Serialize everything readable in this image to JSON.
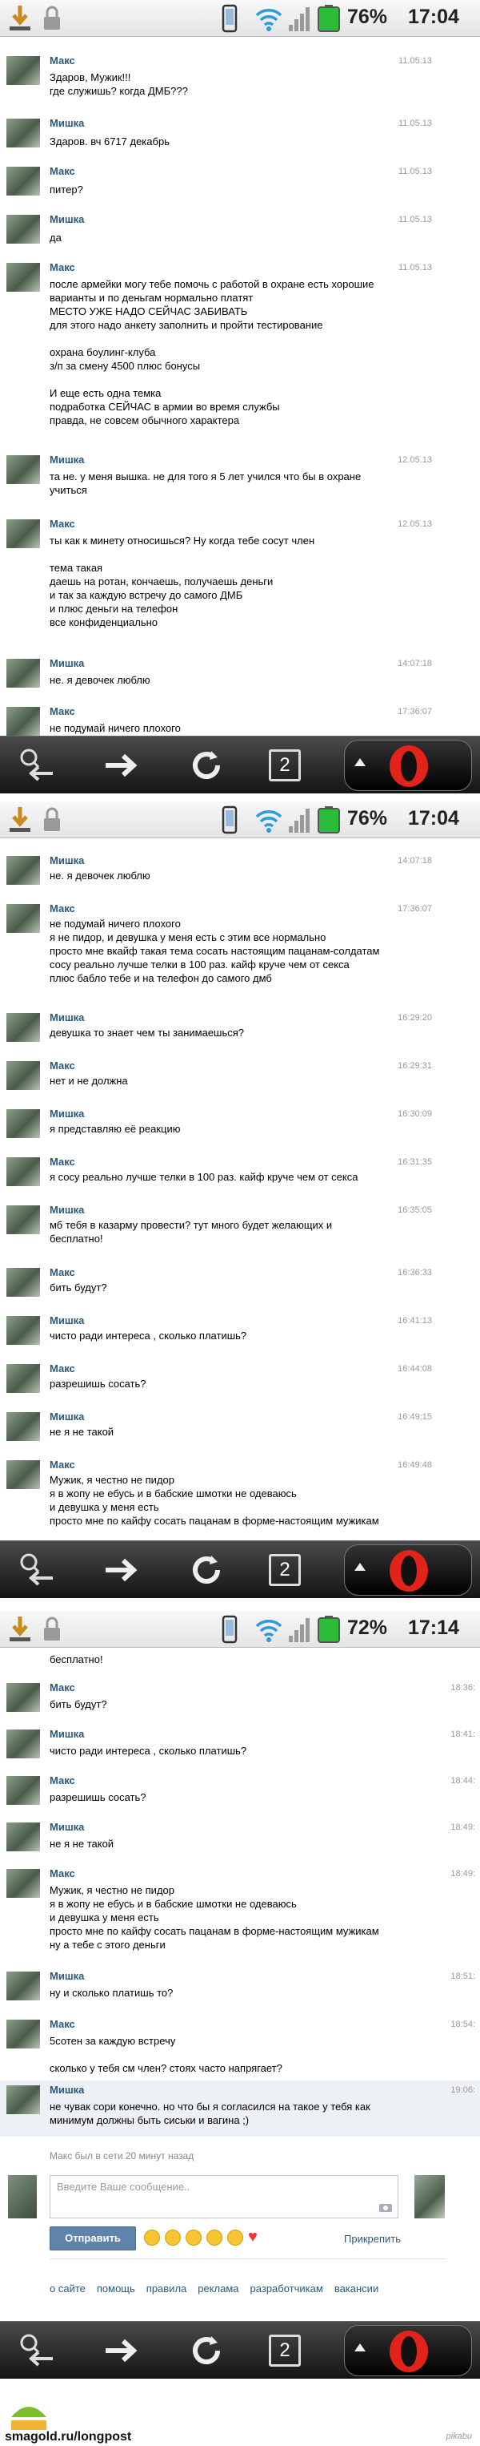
{
  "screens": [
    {
      "status": {
        "battery": "76%",
        "time": "17:04"
      },
      "messages": [
        {
          "name": "Макс",
          "time": "11.05.13",
          "text": "Здаров, Мужик!!!\nгде служишь? когда ДМБ???"
        },
        {
          "name": "Мишка",
          "time": "11.05.13",
          "text": "Здаров. вч 6717 декабрь"
        },
        {
          "name": "Макс",
          "time": "11.05.13",
          "text": "питер?"
        },
        {
          "name": "Мишка",
          "time": "11.05.13",
          "text": "да"
        },
        {
          "name": "Макс",
          "time": "11.05.13",
          "text": "после армейки могу тебе помочь с работой в охране есть хорошие\nварианты и по деньгам нормально платят\nМЕСТО УЖЕ НАДО СЕЙЧАС ЗАБИВАТЬ\nдля этого надо анкету заполнить и пройти тестирование\n\nохрана боулинг-клуба\nз/п за смену 4500 плюс бонусы\n\nИ еще есть одна темка\nподработка СЕЙЧАС в армии во время службы\nправда, не совсем обычного характера"
        },
        {
          "name": "Мишка",
          "time": "12.05.13",
          "text": "та не. у меня вышка. не для того я 5 лет учился что бы в охране\nучиться"
        },
        {
          "name": "Макс",
          "time": "12.05.13",
          "text": "ты как к минету относишься? Ну когда тебе сосут член\n\nтема такая\nдаешь на ротан, кончаешь, получаешь деньги\nи так за каждую встречу до самого ДМБ\nи плюс деньги на телефон\nвсе конфиденциально"
        },
        {
          "name": "Мишка",
          "time": "14:07:18",
          "text": "не. я девочек люблю"
        },
        {
          "name": "Макс",
          "time": "17:36:07",
          "text": "не подумай ничего плохого"
        }
      ]
    },
    {
      "status": {
        "battery": "76%",
        "time": "17:04"
      },
      "messages": [
        {
          "name": "Мишка",
          "time": "14:07:18",
          "text": "не. я девочек люблю"
        },
        {
          "name": "Макс",
          "time": "17:36:07",
          "text": "не подумай ничего плохого\nя не пидор, и девушка у меня есть с этим все нормально\nпросто мне вкайф такая тема сосать настоящим пацанам-солдатам\nсосу реально лучше телки в 100 раз. кайф круче чем от секса\nплюс бабло тебе и на телефон до самого дмб"
        },
        {
          "name": "Мишка",
          "time": "16:29:20",
          "text": "девушка то знает чем ты занимаешься?"
        },
        {
          "name": "Макс",
          "time": "16:29:31",
          "text": "нет и не должна"
        },
        {
          "name": "Мишка",
          "time": "16:30:09",
          "text": "я представляю её реакцию"
        },
        {
          "name": "Макс",
          "time": "16:31:35",
          "text": "я сосу реально лучше телки в 100 раз. кайф круче чем от секса"
        },
        {
          "name": "Мишка",
          "time": "16:35:05",
          "text": "мб тебя в казарму провести? тут много будет желающих и\nбесплатно!"
        },
        {
          "name": "Макс",
          "time": "16:36:33",
          "text": "бить будут?"
        },
        {
          "name": "Мишка",
          "time": "16:41:13",
          "text": "чисто ради интереса , сколько платишь?"
        },
        {
          "name": "Макс",
          "time": "16:44:08",
          "text": "разрешишь сосать?"
        },
        {
          "name": "Мишка",
          "time": "16:49:15",
          "text": "не я не такой"
        },
        {
          "name": "Макс",
          "time": "16:49:48",
          "text": "Мужик, я честно не пидор\nя в жопу не ебусь и в бабские шмотки не одеваюсь\nи девушка у меня есть\nпросто мне по кайфу сосать пацанам в форме-настоящим мужикам"
        }
      ]
    },
    {
      "status": {
        "battery": "72%",
        "time": "17:14"
      },
      "top_continuation": "бесплатно!",
      "messages": [
        {
          "name": "Макс",
          "time": "18:36:",
          "text": "бить будут?"
        },
        {
          "name": "Мишка",
          "time": "18:41:",
          "text": "чисто ради интереса , сколько платишь?"
        },
        {
          "name": "Макс",
          "time": "18:44:",
          "text": "разрешишь сосать?"
        },
        {
          "name": "Мишка",
          "time": "18:49:",
          "text": "не я не такой"
        },
        {
          "name": "Макс",
          "time": "18:49:",
          "text": "Мужик, я честно не пидор\nя в жопу не ебусь и в бабские шмотки не одеваюсь\nи девушка у меня есть\nпросто мне по кайфу сосать пацанам в форме-настоящим мужикам\nну а тебе с этого деньги"
        },
        {
          "name": "Мишка",
          "time": "18:51:",
          "text": "ну и сколько платишь то?"
        },
        {
          "name": "Макс",
          "time": "18:54:",
          "text": "5сотен за каждую встречу\n\nсколько у тебя см член? стоях часто напрягает?"
        },
        {
          "name": "Мишка",
          "time": "19:06:",
          "text": "не чувак сори конечно. но что бы я согласился на такое у тебя как\nминимум должны быть сиськи и вагина ;)"
        }
      ],
      "last_seen": "Макс был в сети 20 минут назад",
      "composer": {
        "placeholder": "Введите Ваше сообщение..",
        "send_label": "Отправить",
        "attach_label": "Прикрепить"
      },
      "footer_links": [
        "о сайте",
        "помощь",
        "правила",
        "реклама",
        "разработчикам",
        "вакансии"
      ]
    }
  ],
  "navbar": {
    "tabs_count": "2"
  },
  "source_url": "smagold.ru/longpost",
  "watermark": "pikabu"
}
